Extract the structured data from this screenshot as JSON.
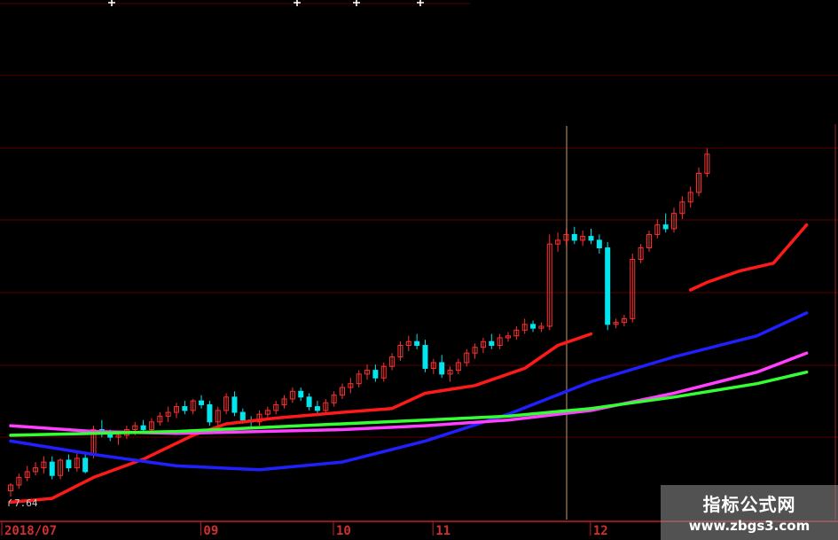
{
  "chart_data": {
    "type": "candlestick",
    "xlabels": [
      {
        "label": "2018/07",
        "index": 0
      },
      {
        "label": "09",
        "index": 24
      },
      {
        "label": "10",
        "index": 40
      },
      {
        "label": "11",
        "index": 52
      },
      {
        "label": "12",
        "index": 71
      }
    ],
    "price_label": "7.64",
    "ylim": [
      7.4,
      11.6
    ],
    "colors": {
      "up": "#ff3030",
      "down": "#00e5ee",
      "ma1": "#ff1a1a",
      "ma2": "#2020ff",
      "ma3": "#ff40ff",
      "ma4": "#33ff33",
      "grid": "#5a0000",
      "vline": "#a08060"
    },
    "candles": [
      [
        7.72,
        7.8,
        7.66,
        7.78
      ],
      [
        7.78,
        7.9,
        7.74,
        7.86
      ],
      [
        7.86,
        7.98,
        7.82,
        7.92
      ],
      [
        7.92,
        8.02,
        7.88,
        7.96
      ],
      [
        7.96,
        8.08,
        7.9,
        8.02
      ],
      [
        8.02,
        8.08,
        7.84,
        7.88
      ],
      [
        7.88,
        8.06,
        7.84,
        8.04
      ],
      [
        8.04,
        8.1,
        7.92,
        7.96
      ],
      [
        7.96,
        8.12,
        7.92,
        8.06
      ],
      [
        8.06,
        8.1,
        7.9,
        7.92
      ],
      [
        8.1,
        8.4,
        8.06,
        8.36
      ],
      [
        8.36,
        8.46,
        8.28,
        8.32
      ],
      [
        8.32,
        8.36,
        8.24,
        8.28
      ],
      [
        8.28,
        8.34,
        8.2,
        8.3
      ],
      [
        8.3,
        8.4,
        8.26,
        8.36
      ],
      [
        8.36,
        8.44,
        8.3,
        8.4
      ],
      [
        8.4,
        8.46,
        8.32,
        8.36
      ],
      [
        8.36,
        8.48,
        8.32,
        8.44
      ],
      [
        8.44,
        8.54,
        8.4,
        8.5
      ],
      [
        8.5,
        8.6,
        8.44,
        8.54
      ],
      [
        8.54,
        8.64,
        8.48,
        8.6
      ],
      [
        8.6,
        8.66,
        8.52,
        8.56
      ],
      [
        8.56,
        8.68,
        8.52,
        8.66
      ],
      [
        8.66,
        8.72,
        8.58,
        8.62
      ],
      [
        8.62,
        8.66,
        8.4,
        8.44
      ],
      [
        8.44,
        8.6,
        8.4,
        8.56
      ],
      [
        8.56,
        8.74,
        8.52,
        8.7
      ],
      [
        8.7,
        8.76,
        8.5,
        8.54
      ],
      [
        8.54,
        8.58,
        8.42,
        8.46
      ],
      [
        8.46,
        8.5,
        8.38,
        8.44
      ],
      [
        8.44,
        8.56,
        8.4,
        8.52
      ],
      [
        8.52,
        8.6,
        8.46,
        8.56
      ],
      [
        8.56,
        8.66,
        8.52,
        8.62
      ],
      [
        8.62,
        8.72,
        8.58,
        8.68
      ],
      [
        8.68,
        8.8,
        8.64,
        8.76
      ],
      [
        8.76,
        8.8,
        8.66,
        8.7
      ],
      [
        8.7,
        8.74,
        8.56,
        8.6
      ],
      [
        8.6,
        8.66,
        8.5,
        8.56
      ],
      [
        8.56,
        8.68,
        8.52,
        8.64
      ],
      [
        8.64,
        8.76,
        8.6,
        8.72
      ],
      [
        8.72,
        8.84,
        8.68,
        8.8
      ],
      [
        8.8,
        8.9,
        8.74,
        8.84
      ],
      [
        8.84,
        8.98,
        8.8,
        8.94
      ],
      [
        8.94,
        9.04,
        8.88,
        8.98
      ],
      [
        8.98,
        9.04,
        8.86,
        8.9
      ],
      [
        8.9,
        9.06,
        8.86,
        9.02
      ],
      [
        9.02,
        9.16,
        8.98,
        9.12
      ],
      [
        9.12,
        9.28,
        9.08,
        9.24
      ],
      [
        9.24,
        9.34,
        9.18,
        9.28
      ],
      [
        9.28,
        9.36,
        9.2,
        9.24
      ],
      [
        9.24,
        9.3,
        8.96,
        9.0
      ],
      [
        9.0,
        9.1,
        8.94,
        9.06
      ],
      [
        9.06,
        9.14,
        8.9,
        8.94
      ],
      [
        8.94,
        9.02,
        8.86,
        8.98
      ],
      [
        8.98,
        9.1,
        8.94,
        9.06
      ],
      [
        9.06,
        9.2,
        9.02,
        9.16
      ],
      [
        9.16,
        9.26,
        9.1,
        9.22
      ],
      [
        9.22,
        9.32,
        9.16,
        9.28
      ],
      [
        9.28,
        9.36,
        9.2,
        9.24
      ],
      [
        9.24,
        9.36,
        9.2,
        9.32
      ],
      [
        9.32,
        9.38,
        9.28,
        9.34
      ],
      [
        9.34,
        9.44,
        9.3,
        9.4
      ],
      [
        9.4,
        9.52,
        9.36,
        9.46
      ],
      [
        9.46,
        9.5,
        9.38,
        9.42
      ],
      [
        9.42,
        9.48,
        9.38,
        9.44
      ],
      [
        9.44,
        10.4,
        9.4,
        10.3
      ],
      [
        10.3,
        10.42,
        10.22,
        10.34
      ],
      [
        10.34,
        10.46,
        10.28,
        10.4
      ],
      [
        10.4,
        10.48,
        10.3,
        10.34
      ],
      [
        10.34,
        10.44,
        10.28,
        10.38
      ],
      [
        10.38,
        10.46,
        10.3,
        10.34
      ],
      [
        10.34,
        10.4,
        10.2,
        10.26
      ],
      [
        10.26,
        10.32,
        9.4,
        9.46
      ],
      [
        9.46,
        9.52,
        9.42,
        9.48
      ],
      [
        9.48,
        9.56,
        9.44,
        9.52
      ],
      [
        9.52,
        10.2,
        9.48,
        10.14
      ],
      [
        10.14,
        10.3,
        10.1,
        10.26
      ],
      [
        10.26,
        10.44,
        10.22,
        10.4
      ],
      [
        10.4,
        10.56,
        10.36,
        10.5
      ],
      [
        10.5,
        10.62,
        10.42,
        10.46
      ],
      [
        10.46,
        10.68,
        10.42,
        10.62
      ],
      [
        10.62,
        10.8,
        10.56,
        10.74
      ],
      [
        10.74,
        10.9,
        10.68,
        10.84
      ],
      [
        10.84,
        11.1,
        10.8,
        11.04
      ],
      [
        11.04,
        11.3,
        11.0,
        11.24
      ]
    ],
    "ma": [
      {
        "color": "#ff1a1a",
        "width": 3.5,
        "values": [
          [
            0,
            7.6
          ],
          [
            5,
            7.64
          ],
          [
            10,
            7.86
          ],
          [
            16,
            8.05
          ],
          [
            22,
            8.3
          ],
          [
            26,
            8.42
          ],
          [
            32,
            8.48
          ],
          [
            40,
            8.54
          ],
          [
            46,
            8.58
          ],
          [
            50,
            8.74
          ],
          [
            56,
            8.82
          ],
          [
            62,
            9.0
          ],
          [
            66,
            9.24
          ],
          [
            70,
            9.36
          ]
        ]
      },
      {
        "color": "#ff1a1a",
        "width": 3.5,
        "values": [
          [
            82,
            9.82
          ],
          [
            84,
            9.9
          ],
          [
            88,
            10.02
          ],
          [
            92,
            10.1
          ],
          [
            96,
            10.5
          ]
        ]
      },
      {
        "color": "#2020ff",
        "width": 3.5,
        "values": [
          [
            0,
            8.24
          ],
          [
            10,
            8.1
          ],
          [
            20,
            7.98
          ],
          [
            30,
            7.94
          ],
          [
            40,
            8.02
          ],
          [
            50,
            8.24
          ],
          [
            60,
            8.52
          ],
          [
            70,
            8.86
          ],
          [
            80,
            9.12
          ],
          [
            90,
            9.34
          ],
          [
            96,
            9.58
          ]
        ]
      },
      {
        "color": "#ff40ff",
        "width": 3.5,
        "values": [
          [
            0,
            8.4
          ],
          [
            10,
            8.34
          ],
          [
            20,
            8.32
          ],
          [
            30,
            8.34
          ],
          [
            40,
            8.36
          ],
          [
            50,
            8.4
          ],
          [
            60,
            8.46
          ],
          [
            70,
            8.56
          ],
          [
            80,
            8.74
          ],
          [
            90,
            8.96
          ],
          [
            96,
            9.16
          ]
        ]
      },
      {
        "color": "#33ff33",
        "width": 3.5,
        "values": [
          [
            0,
            8.3
          ],
          [
            10,
            8.32
          ],
          [
            20,
            8.34
          ],
          [
            30,
            8.38
          ],
          [
            40,
            8.42
          ],
          [
            50,
            8.46
          ],
          [
            60,
            8.5
          ],
          [
            70,
            8.58
          ],
          [
            80,
            8.7
          ],
          [
            90,
            8.84
          ],
          [
            96,
            8.96
          ]
        ]
      }
    ]
  },
  "watermark": {
    "line1": "指标公式网",
    "line2": "www.zbgs3.com"
  }
}
